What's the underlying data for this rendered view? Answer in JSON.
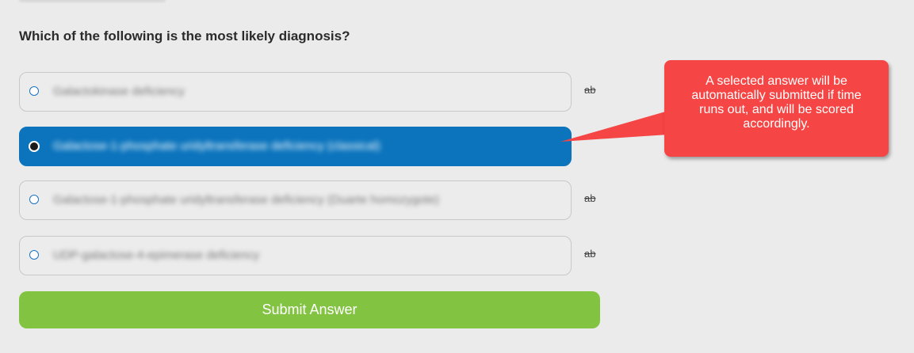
{
  "question": {
    "text": "Which of the following is the most likely diagnosis?"
  },
  "options": [
    {
      "text": "Galactokinase deficiency",
      "selected": false,
      "strike_label": "ab"
    },
    {
      "text": "Galactose-1-phosphate uridyltransferase deficiency (classical)",
      "selected": true,
      "strike_label": ""
    },
    {
      "text": "Galactose-1-phosphate uridyltransferase deficiency (Duarte homozygote)",
      "selected": false,
      "strike_label": "ab"
    },
    {
      "text": "UDP-galactose-4-epimerase deficiency",
      "selected": false,
      "strike_label": "ab"
    }
  ],
  "submit": {
    "label": "Submit Answer"
  },
  "callout": {
    "text": "A selected answer will be automatically submitted if time runs out, and will be scored accordingly."
  },
  "colors": {
    "background": "#ebebeb",
    "selected": "#0b74bd",
    "submit": "#82c341",
    "callout": "#f64545"
  }
}
